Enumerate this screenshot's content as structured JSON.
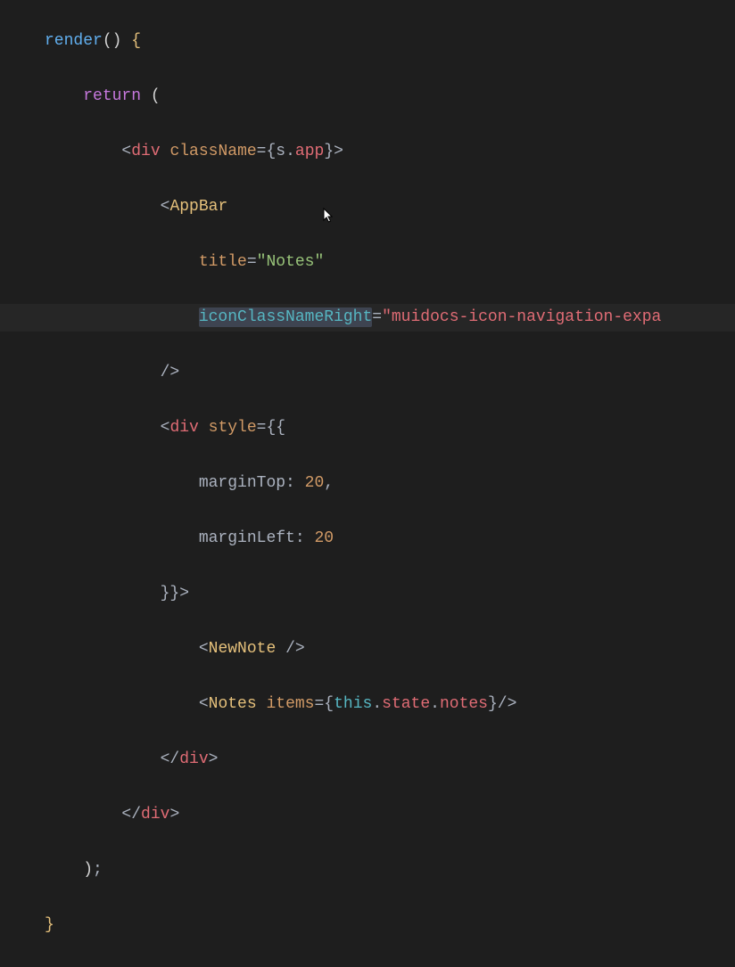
{
  "code": {
    "line1": {
      "method": "render",
      "parens": "()",
      "space": " ",
      "brace": "{"
    },
    "line2": {
      "keyword": "return",
      "space": " ",
      "paren": "("
    },
    "line3": {
      "open": "<",
      "tag": "div",
      "sp": " ",
      "attr": "className",
      "eq": "=",
      "lb": "{",
      "obj": "s",
      "dot": ".",
      "prop": "app",
      "rb": "}",
      "close": ">"
    },
    "line4": {
      "open": "<",
      "comp": "AppBar"
    },
    "line5": {
      "attr": "title",
      "eq": "=",
      "val": "\"Notes\""
    },
    "line6": {
      "attr": "iconClassNameRight",
      "eq": "=",
      "val": "\"muidocs-icon-navigation-expa"
    },
    "line7": {
      "close": "/>"
    },
    "line8": {
      "open": "<",
      "tag": "div",
      "sp": " ",
      "attr": "style",
      "eq": "=",
      "lb": "{{"
    },
    "line9": {
      "prop": "marginTop",
      "colon": ":",
      "sp": " ",
      "num": "20",
      "comma": ","
    },
    "line10": {
      "prop": "marginLeft",
      "colon": ":",
      "sp": " ",
      "num": "20"
    },
    "line11": {
      "rb": "}}",
      "close": ">"
    },
    "line12": {
      "open": "<",
      "comp": "NewNote",
      "sp": " ",
      "close": "/>"
    },
    "line13": {
      "open": "<",
      "comp": "Notes",
      "sp": " ",
      "attr": "items",
      "eq": "=",
      "lb": "{",
      "this": "this",
      "dot1": ".",
      "state": "state",
      "dot2": ".",
      "notes": "notes",
      "rb": "}",
      "close": "/>"
    },
    "line14": {
      "open": "</",
      "tag": "div",
      "close": ">"
    },
    "line15": {
      "open": "</",
      "tag": "div",
      "close": ">"
    },
    "line16": {
      "paren": ")",
      "semi": ";"
    },
    "line17": {
      "brace": "}"
    }
  }
}
